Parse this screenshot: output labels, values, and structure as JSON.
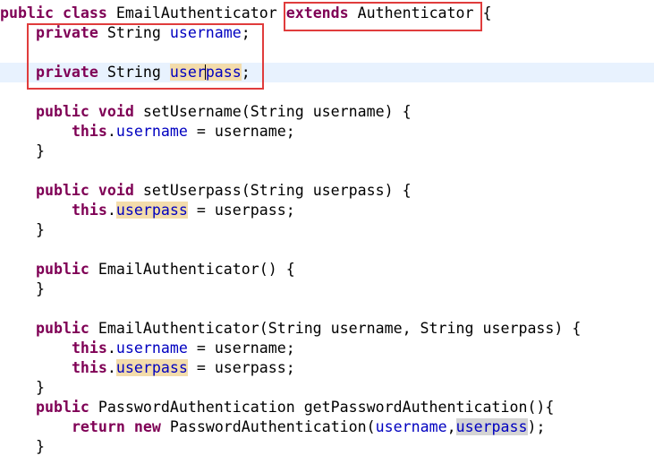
{
  "code": {
    "lines": [
      {
        "id": "l1",
        "tokens": [
          [
            "kw",
            "public"
          ],
          [
            "t",
            " "
          ],
          [
            "kw",
            "class"
          ],
          [
            "t",
            " EmailAuthenticator "
          ],
          [
            "kw",
            "extends"
          ],
          [
            "t",
            " Authenticator {"
          ]
        ]
      },
      {
        "id": "l2",
        "tokens": [
          [
            "t",
            "    "
          ],
          [
            "kw",
            "private"
          ],
          [
            "t",
            " String "
          ],
          [
            "fld",
            "username"
          ],
          [
            "t",
            ";"
          ]
        ]
      },
      {
        "id": "l3",
        "tokens": [
          [
            "t",
            ""
          ]
        ]
      },
      {
        "id": "l4",
        "tokens": [
          [
            "t",
            "    "
          ],
          [
            "kw",
            "private"
          ],
          [
            "t",
            " String "
          ],
          [
            "fld-occ-caret",
            "userpass"
          ],
          [
            "t",
            ";"
          ]
        ],
        "current": true
      },
      {
        "id": "l5",
        "tokens": [
          [
            "t",
            ""
          ]
        ]
      },
      {
        "id": "l6",
        "tokens": [
          [
            "t",
            "    "
          ],
          [
            "kw",
            "public"
          ],
          [
            "t",
            " "
          ],
          [
            "kw",
            "void"
          ],
          [
            "t",
            " setUsername(String username) {"
          ]
        ]
      },
      {
        "id": "l7",
        "tokens": [
          [
            "t",
            "        "
          ],
          [
            "kw",
            "this"
          ],
          [
            "t",
            "."
          ],
          [
            "fld",
            "username"
          ],
          [
            "t",
            " = username;"
          ]
        ]
      },
      {
        "id": "l8",
        "tokens": [
          [
            "t",
            "    }"
          ]
        ]
      },
      {
        "id": "l9",
        "tokens": [
          [
            "t",
            ""
          ]
        ]
      },
      {
        "id": "l10",
        "tokens": [
          [
            "t",
            "    "
          ],
          [
            "kw",
            "public"
          ],
          [
            "t",
            " "
          ],
          [
            "kw",
            "void"
          ],
          [
            "t",
            " setUserpass(String userpass) {"
          ]
        ]
      },
      {
        "id": "l11",
        "tokens": [
          [
            "t",
            "        "
          ],
          [
            "kw",
            "this"
          ],
          [
            "t",
            "."
          ],
          [
            "fld-occ",
            "userpass"
          ],
          [
            "t",
            " = userpass;"
          ]
        ]
      },
      {
        "id": "l12",
        "tokens": [
          [
            "t",
            "    }"
          ]
        ]
      },
      {
        "id": "l13",
        "tokens": [
          [
            "t",
            ""
          ]
        ]
      },
      {
        "id": "l14",
        "tokens": [
          [
            "t",
            "    "
          ],
          [
            "kw",
            "public"
          ],
          [
            "t",
            " EmailAuthenticator() {"
          ]
        ]
      },
      {
        "id": "l15",
        "tokens": [
          [
            "t",
            "    }"
          ]
        ]
      },
      {
        "id": "l16",
        "tokens": [
          [
            "t",
            ""
          ]
        ]
      },
      {
        "id": "l17",
        "tokens": [
          [
            "t",
            "    "
          ],
          [
            "kw",
            "public"
          ],
          [
            "t",
            " EmailAuthenticator(String username, String userpass) {"
          ]
        ]
      },
      {
        "id": "l18",
        "tokens": [
          [
            "t",
            "        "
          ],
          [
            "kw",
            "this"
          ],
          [
            "t",
            "."
          ],
          [
            "fld",
            "username"
          ],
          [
            "t",
            " = username;"
          ]
        ]
      },
      {
        "id": "l19",
        "tokens": [
          [
            "t",
            "        "
          ],
          [
            "kw",
            "this"
          ],
          [
            "t",
            "."
          ],
          [
            "fld-occ",
            "userpass"
          ],
          [
            "t",
            " = userpass;"
          ]
        ]
      },
      {
        "id": "l20",
        "tokens": [
          [
            "t",
            "    }"
          ]
        ]
      },
      {
        "id": "l21",
        "tokens": [
          [
            "t",
            "    "
          ],
          [
            "kw",
            "public"
          ],
          [
            "t",
            " PasswordAuthentication getPasswordAuthentication(){"
          ]
        ]
      },
      {
        "id": "l22",
        "tokens": [
          [
            "t",
            "        "
          ],
          [
            "kw",
            "return"
          ],
          [
            "t",
            " "
          ],
          [
            "kw",
            "new"
          ],
          [
            "t",
            " PasswordAuthentication("
          ],
          [
            "fld",
            "username"
          ],
          [
            "t",
            ","
          ],
          [
            "fld-occsel",
            "userpass"
          ],
          [
            "t",
            ");"
          ]
        ]
      },
      {
        "id": "l23",
        "tokens": [
          [
            "t",
            "    }"
          ]
        ]
      }
    ]
  },
  "colors": {
    "keyword": "#7f0055",
    "field": "#0000c0",
    "occurrence_highlight": "#f3dcab",
    "current_line": "#e8f2fe",
    "annotation_box": "#e03c3c"
  }
}
